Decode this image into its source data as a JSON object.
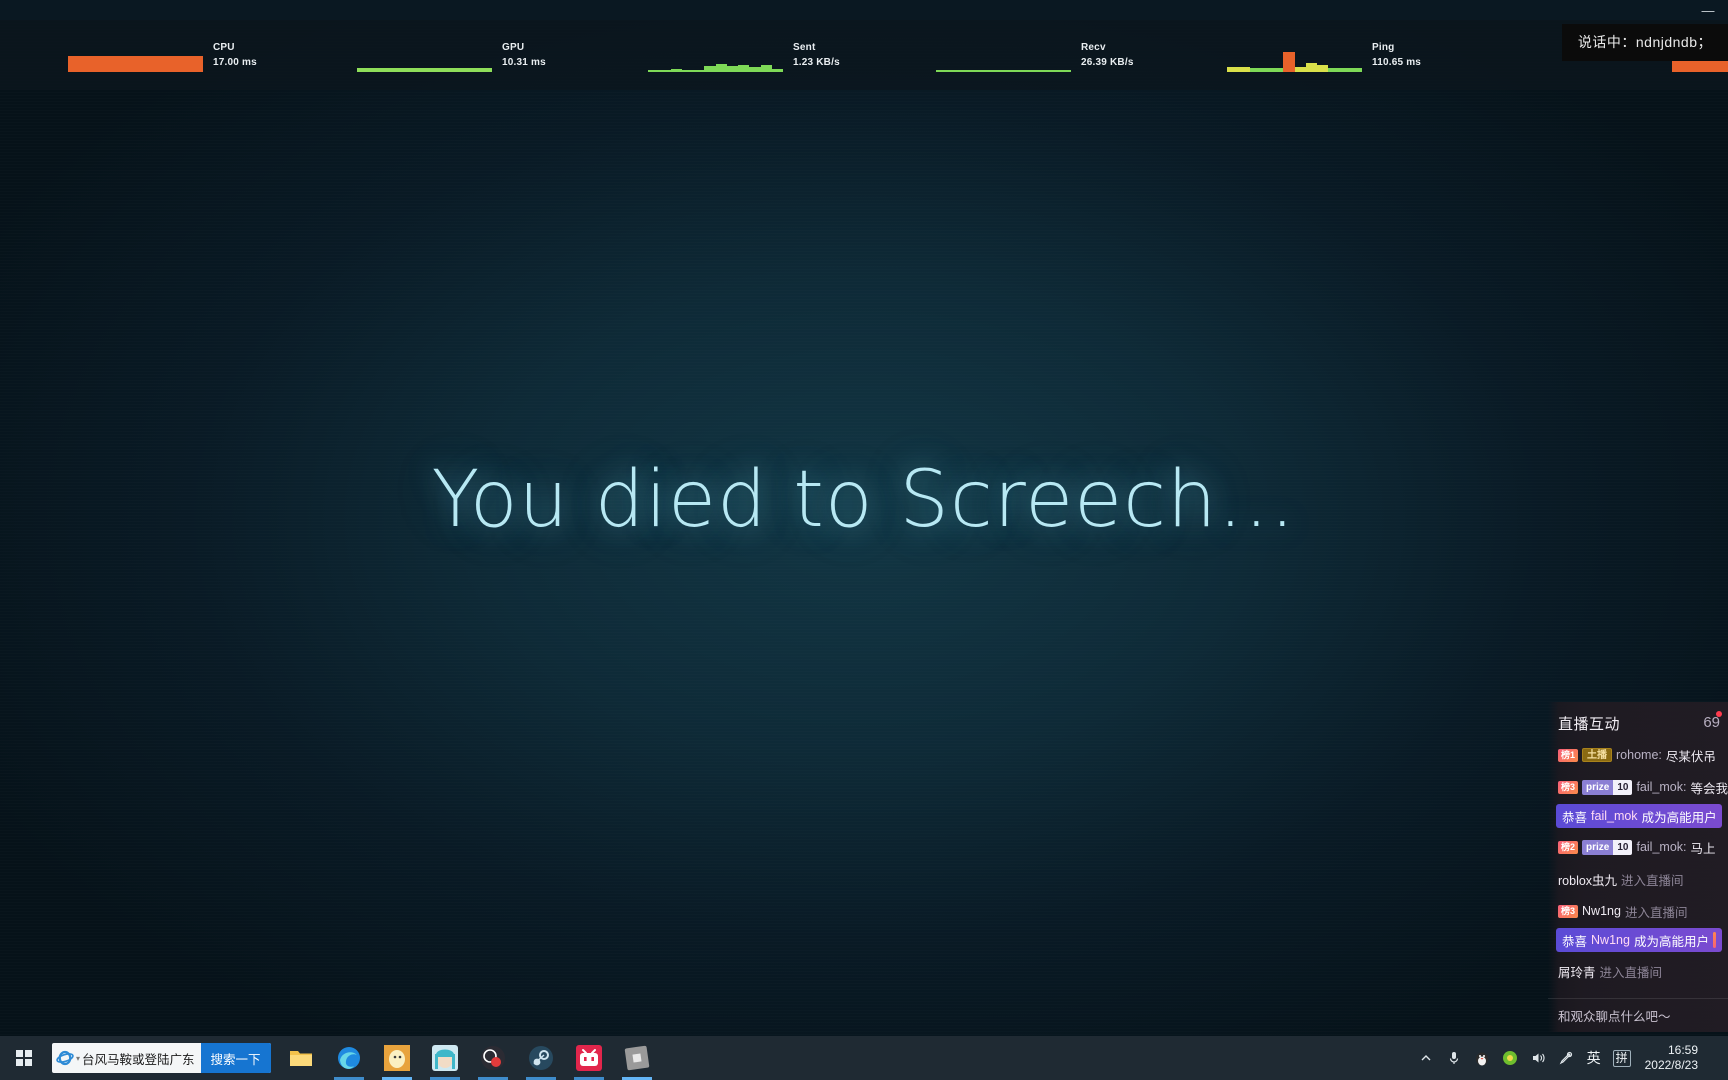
{
  "window": {
    "minimize_label": "—"
  },
  "stats": {
    "items": [
      {
        "name": "CPU",
        "value": "17.00 ms",
        "color": "#e8622a",
        "style": "solid-bar"
      },
      {
        "name": "GPU",
        "value": "10.31 ms",
        "color": "#8ede5a",
        "style": "thin-bar"
      },
      {
        "name": "Sent",
        "value": "1.23 KB/s",
        "color": "#7ed957",
        "style": "wave-low"
      },
      {
        "name": "Recv",
        "value": "26.39 KB/s",
        "color": "#7ed957",
        "style": "flat-line"
      },
      {
        "name": "Ping",
        "value": "110.65 ms",
        "color": "#d9e04a",
        "style": "wave-mixed"
      }
    ]
  },
  "toast": {
    "speaking": "说话中：ndnjdndb；"
  },
  "game": {
    "death_message": "You died to Screech…"
  },
  "chat": {
    "title": "直播互动",
    "count_glyph": "69",
    "messages": [
      {
        "kind": "message",
        "level_badge": "榜1",
        "fan_badge": "土播",
        "user": "rohome:",
        "text": "尽某伏吊"
      },
      {
        "kind": "message",
        "level_badge": "榜3",
        "prize_label": "prize",
        "prize_value": "10",
        "user": "fail_mok:",
        "text": "等会我"
      },
      {
        "kind": "banner",
        "prefix": "恭喜",
        "user": "fail_mok",
        "suffix": "成为高能用户"
      },
      {
        "kind": "message",
        "level_badge": "榜2",
        "prize_label": "prize",
        "prize_value": "10",
        "user": "fail_mok:",
        "text": "马上"
      },
      {
        "kind": "enter",
        "user": "roblox虫九",
        "text": "进入直播间"
      },
      {
        "kind": "enter",
        "level_badge": "榜3",
        "user": "Nw1ng",
        "text": "进入直播间"
      },
      {
        "kind": "banner",
        "prefix": "恭喜",
        "user": "Nw1ng",
        "suffix": "成为高能用户"
      },
      {
        "kind": "enter",
        "user": "屑玲青",
        "text": "进入直播间"
      }
    ],
    "input_placeholder": "和观众聊点什么吧～"
  },
  "taskbar": {
    "start_label": "⊞",
    "search": {
      "news_text": "台风马鞍或登陆广东",
      "caret": "▾",
      "button_label": "搜索一下"
    },
    "apps": [
      {
        "name": "file-explorer",
        "icon": "folder",
        "color": "#f2c14b",
        "state": "idle"
      },
      {
        "name": "microsoft-edge",
        "icon": "edge",
        "color": "#1f8ae0",
        "state": "running"
      },
      {
        "name": "unknown-app",
        "icon": "egg",
        "color": "#e8a33d",
        "state": "active"
      },
      {
        "name": "hatsune-miku-app",
        "icon": "miku",
        "color": "#3fb7c9",
        "state": "running"
      },
      {
        "name": "obs-studio",
        "icon": "obs",
        "color": "#2d2d2d",
        "state": "running"
      },
      {
        "name": "steam",
        "icon": "steam",
        "color": "#27495f",
        "state": "running"
      },
      {
        "name": "bilibili",
        "icon": "bilibili",
        "color": "#e2264c",
        "state": "running"
      },
      {
        "name": "roblox",
        "icon": "roblox",
        "color": "#8a8a8a",
        "state": "active"
      }
    ],
    "tray": {
      "chevron": "︿",
      "microphone": "🎤",
      "qq": "🐧",
      "update": "●",
      "volume": "🔊",
      "pen": "✎",
      "ime_lang": "英",
      "ime_mode": "拼",
      "time": "16:59",
      "date": "2022/8/23"
    }
  },
  "colors": {
    "accent_blue": "#1675d1",
    "death_text": "#b7e8f3",
    "taskbar_bg": "#1f2a33",
    "chat_banner": "#5b4bd6"
  }
}
